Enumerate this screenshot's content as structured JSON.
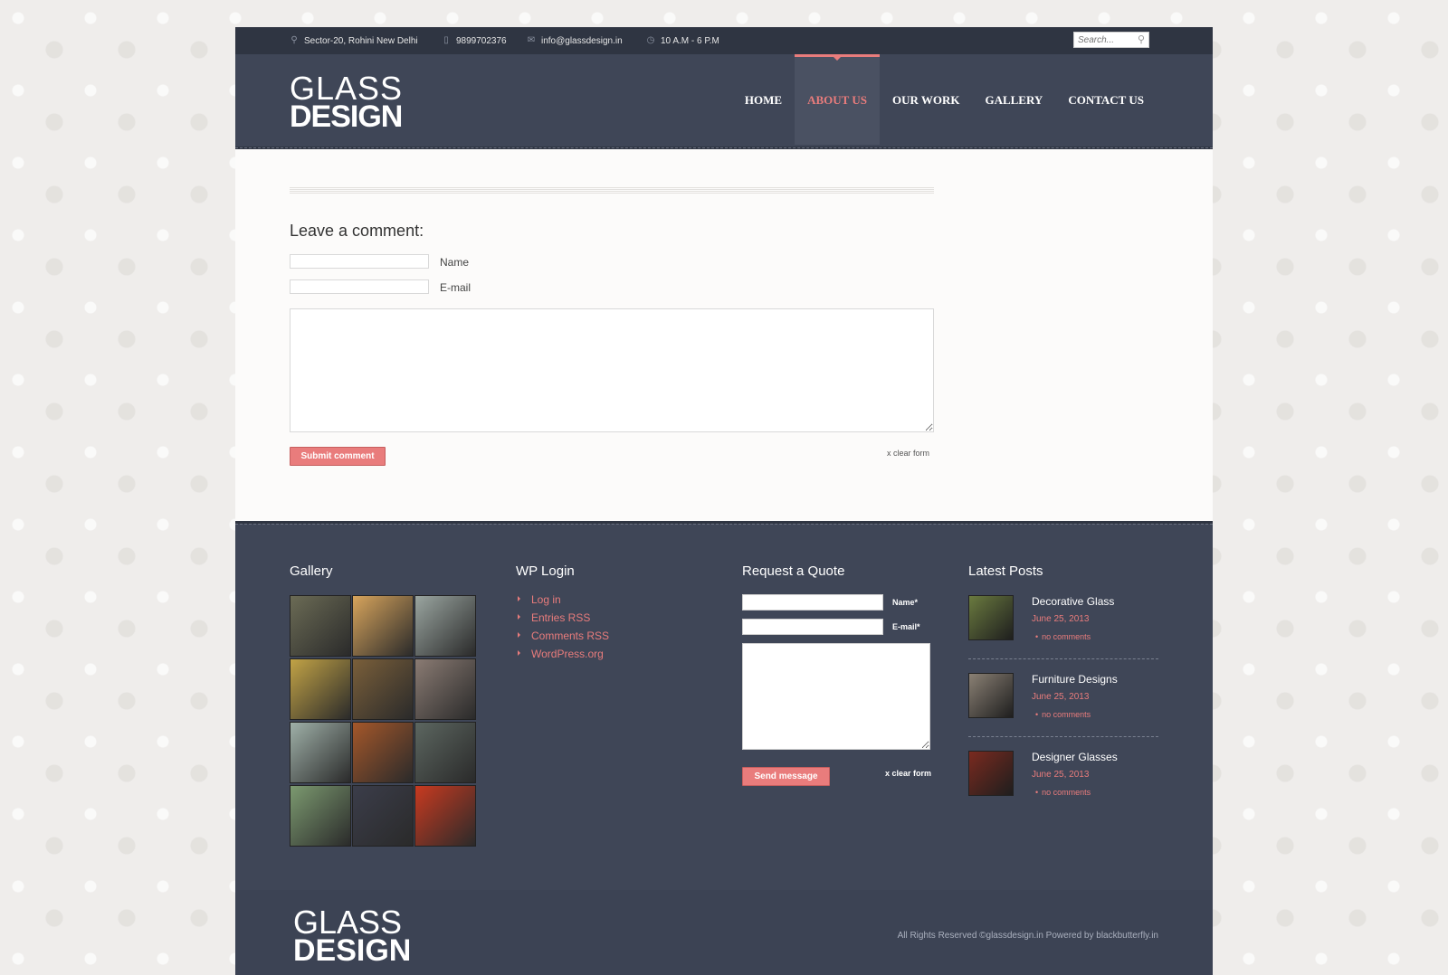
{
  "topbar": {
    "address": "Sector-20, Rohini New Delhi",
    "phone": "9899702376",
    "email": "info@glassdesign.in",
    "hours": "10 A.M - 6 P.M",
    "search_placeholder": "Search..."
  },
  "logo": {
    "line1": "GLASS",
    "line2": "DESIGN"
  },
  "nav": {
    "items": [
      {
        "label": "HOME"
      },
      {
        "label": "ABOUT US"
      },
      {
        "label": "OUR WORK"
      },
      {
        "label": "GALLERY"
      },
      {
        "label": "CONTACT US"
      }
    ],
    "active_color": "#e97c7c"
  },
  "comment": {
    "heading": "Leave a comment:",
    "name_label": "Name",
    "email_label": "E-mail",
    "submit_label": "Submit comment",
    "clear_label": "x clear form"
  },
  "footer": {
    "gallery_title": "Gallery",
    "gallery_colors": [
      "#6b6b55",
      "#d7a45c",
      "#9aa5a0",
      "#c2a346",
      "#7a5f3a",
      "#8a7b73",
      "#9fb0a8",
      "#a4572a",
      "#5c6660",
      "#7c9a70",
      "#3b3d4a",
      "#c83a20"
    ],
    "wp_title": "WP Login",
    "wp_links": [
      "Log in",
      "Entries RSS",
      "Comments RSS",
      "WordPress.org"
    ],
    "quote_title": "Request a Quote",
    "quote_name_label": "Name*",
    "quote_email_label": "E-mail*",
    "quote_send_label": "Send message",
    "quote_clear_label": "x clear form",
    "posts_title": "Latest Posts",
    "posts": [
      {
        "title": "Decorative Glass",
        "date": "June 25, 2013",
        "comments": "no comments",
        "color": "#6a7a3f"
      },
      {
        "title": "Furniture Designs",
        "date": "June 25, 2013",
        "comments": "no comments",
        "color": "#8a8074"
      },
      {
        "title": "Designer Glasses",
        "date": "June 25, 2013",
        "comments": "no comments",
        "color": "#7a2a1f"
      }
    ]
  },
  "bottom": {
    "logo_line1": "GLASS",
    "logo_line2": "DESIGN",
    "copyright": "All Rights Reserved ©glassdesign.in Powered by blackbutterfly.in"
  },
  "colors": {
    "accent": "#e97c7c",
    "header_bg": "#3f4657",
    "topbar_bg": "#2f3542"
  }
}
